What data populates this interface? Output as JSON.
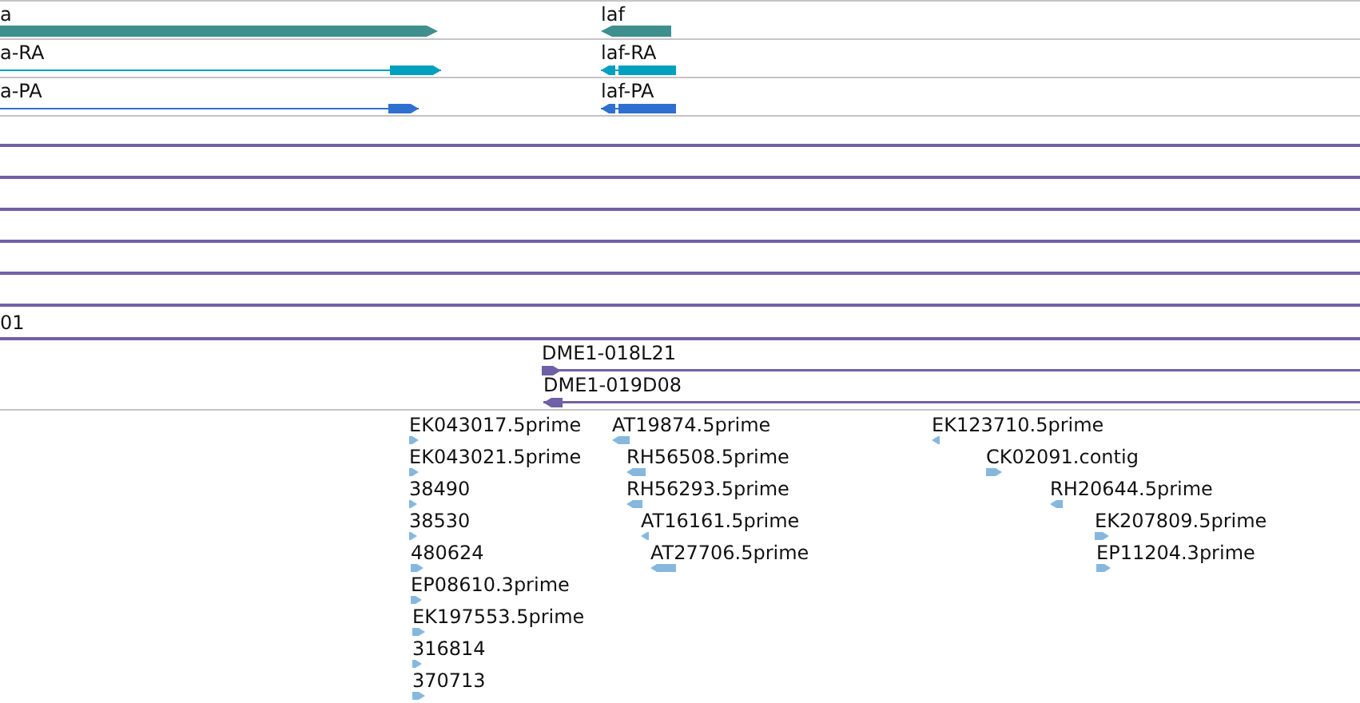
{
  "tracks": [
    {
      "kind": "gene",
      "features": [
        {
          "label": "a",
          "reverse": false
        },
        {
          "label": "laf",
          "reverse": true
        }
      ]
    },
    {
      "kind": "mrna",
      "features": [
        {
          "label": "a-RA",
          "reverse": false
        },
        {
          "label": "laf-RA",
          "reverse": true
        }
      ]
    },
    {
      "kind": "polypeptide",
      "features": [
        {
          "label": "a-PA",
          "reverse": false
        },
        {
          "label": "laf-PA",
          "reverse": true
        }
      ]
    },
    {
      "kind": "clone",
      "features": [
        {
          "kind": "span"
        },
        {
          "kind": "span"
        },
        {
          "kind": "span"
        },
        {
          "kind": "span"
        },
        {
          "kind": "span"
        },
        {
          "kind": "span"
        },
        {
          "kind": "span",
          "label": "01"
        },
        {
          "kind": "clone",
          "label": "DME1-018L21",
          "reverse": false
        },
        {
          "kind": "clone",
          "label": "DME1-019D08",
          "reverse": true
        }
      ]
    },
    {
      "kind": "est",
      "features": [
        {
          "label": "EK043017.5prime",
          "reverse": false
        },
        {
          "label": "EK043021.5prime",
          "reverse": false
        },
        {
          "label": "38490",
          "reverse": false
        },
        {
          "label": "38530",
          "reverse": false
        },
        {
          "label": "480624",
          "reverse": false
        },
        {
          "label": "EP08610.3prime",
          "reverse": false
        },
        {
          "label": "EK197553.5prime",
          "reverse": false
        },
        {
          "label": "316814",
          "reverse": false
        },
        {
          "label": "370713",
          "reverse": false
        },
        {
          "label": "AT19874.5prime",
          "reverse": true
        },
        {
          "label": "RH56508.5prime",
          "reverse": true
        },
        {
          "label": "RH56293.5prime",
          "reverse": true
        },
        {
          "label": "AT16161.5prime",
          "reverse": true
        },
        {
          "label": "AT27706.5prime",
          "reverse": true
        },
        {
          "label": "EK123710.5prime",
          "reverse": true
        },
        {
          "label": "CK02091.contig",
          "reverse": false
        },
        {
          "label": "RH20644.5prime",
          "reverse": true
        },
        {
          "label": "EK207809.5prime",
          "reverse": false
        },
        {
          "label": "EP11204.3prime",
          "reverse": false
        }
      ]
    }
  ]
}
